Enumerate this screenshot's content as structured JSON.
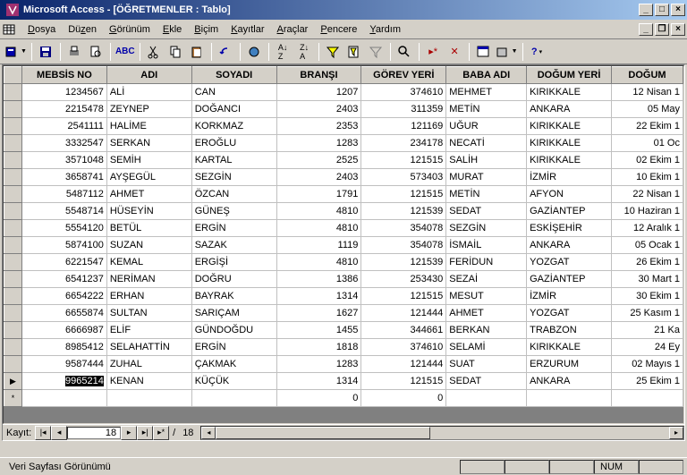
{
  "window": {
    "title": "Microsoft Access - [ÖĞRETMENLER : Tablo]"
  },
  "menu": {
    "items": [
      "Dosya",
      "Düzen",
      "Görünüm",
      "Ekle",
      "Biçim",
      "Kayıtlar",
      "Araçlar",
      "Pencere",
      "Yardım"
    ]
  },
  "nav": {
    "label": "Kayıt:",
    "current": "18",
    "total": "18",
    "sep": "/"
  },
  "status": {
    "view": "Veri Sayfası Görünümü",
    "num": "NUM"
  },
  "columns": [
    "MEBSİS NO",
    "ADI",
    "SOYADI",
    "BRANŞI",
    "GÖREV YERİ",
    "BABA ADI",
    "DOĞUM YERİ",
    "DOĞUM"
  ],
  "rows": [
    {
      "sel": "",
      "mebsis": "1234567",
      "adi": "ALİ",
      "soyadi": "CAN",
      "bransi": "1207",
      "gorev": "374610",
      "baba": "MEHMET",
      "dogumyeri": "KIRIKKALE",
      "dogum": "12 Nisan 1"
    },
    {
      "sel": "",
      "mebsis": "2215478",
      "adi": "ZEYNEP",
      "soyadi": "DOĞANCI",
      "bransi": "2403",
      "gorev": "311359",
      "baba": "METİN",
      "dogumyeri": "ANKARA",
      "dogum": "05 May"
    },
    {
      "sel": "",
      "mebsis": "2541111",
      "adi": "HALİME",
      "soyadi": "KORKMAZ",
      "bransi": "2353",
      "gorev": "121169",
      "baba": "UĞUR",
      "dogumyeri": "KIRIKKALE",
      "dogum": "22 Ekim 1"
    },
    {
      "sel": "",
      "mebsis": "3332547",
      "adi": "SERKAN",
      "soyadi": "EROĞLU",
      "bransi": "1283",
      "gorev": "234178",
      "baba": "NECATİ",
      "dogumyeri": "KIRIKKALE",
      "dogum": "01 Oc"
    },
    {
      "sel": "",
      "mebsis": "3571048",
      "adi": "SEMİH",
      "soyadi": "KARTAL",
      "bransi": "2525",
      "gorev": "121515",
      "baba": "SALİH",
      "dogumyeri": "KIRIKKALE",
      "dogum": "02 Ekim 1"
    },
    {
      "sel": "",
      "mebsis": "3658741",
      "adi": "AYŞEGÜL",
      "soyadi": "SEZGİN",
      "bransi": "2403",
      "gorev": "573403",
      "baba": "MURAT",
      "dogumyeri": "İZMİR",
      "dogum": "10 Ekim 1"
    },
    {
      "sel": "",
      "mebsis": "5487112",
      "adi": "AHMET",
      "soyadi": "ÖZCAN",
      "bransi": "1791",
      "gorev": "121515",
      "baba": "METİN",
      "dogumyeri": "AFYON",
      "dogum": "22 Nisan 1"
    },
    {
      "sel": "",
      "mebsis": "5548714",
      "adi": "HÜSEYİN",
      "soyadi": "GÜNEŞ",
      "bransi": "4810",
      "gorev": "121539",
      "baba": "SEDAT",
      "dogumyeri": "GAZİANTEP",
      "dogum": "10 Haziran 1"
    },
    {
      "sel": "",
      "mebsis": "5554120",
      "adi": "BETÜL",
      "soyadi": "ERGİN",
      "bransi": "4810",
      "gorev": "354078",
      "baba": "SEZGİN",
      "dogumyeri": "ESKİŞEHİR",
      "dogum": "12 Aralık 1"
    },
    {
      "sel": "",
      "mebsis": "5874100",
      "adi": "SUZAN",
      "soyadi": "SAZAK",
      "bransi": "1119",
      "gorev": "354078",
      "baba": "İSMAİL",
      "dogumyeri": "ANKARA",
      "dogum": "05 Ocak 1"
    },
    {
      "sel": "",
      "mebsis": "6221547",
      "adi": "KEMAL",
      "soyadi": "ERGİŞİ",
      "bransi": "4810",
      "gorev": "121539",
      "baba": "FERİDUN",
      "dogumyeri": "YOZGAT",
      "dogum": "26 Ekim 1"
    },
    {
      "sel": "",
      "mebsis": "6541237",
      "adi": "NERİMAN",
      "soyadi": "DOĞRU",
      "bransi": "1386",
      "gorev": "253430",
      "baba": "SEZAİ",
      "dogumyeri": "GAZİANTEP",
      "dogum": "30 Mart 1"
    },
    {
      "sel": "",
      "mebsis": "6654222",
      "adi": "ERHAN",
      "soyadi": "BAYRAK",
      "bransi": "1314",
      "gorev": "121515",
      "baba": "MESUT",
      "dogumyeri": "İZMİR",
      "dogum": "30 Ekim 1"
    },
    {
      "sel": "",
      "mebsis": "6655874",
      "adi": "SULTAN",
      "soyadi": "SARIÇAM",
      "bransi": "1627",
      "gorev": "121444",
      "baba": "AHMET",
      "dogumyeri": "YOZGAT",
      "dogum": "25 Kasım 1"
    },
    {
      "sel": "",
      "mebsis": "6666987",
      "adi": "ELİF",
      "soyadi": "GÜNDOĞDU",
      "bransi": "1455",
      "gorev": "344661",
      "baba": "BERKAN",
      "dogumyeri": "TRABZON",
      "dogum": "21 Ka"
    },
    {
      "sel": "",
      "mebsis": "8985412",
      "adi": "SELAHATTİN",
      "soyadi": "ERGİN",
      "bransi": "1818",
      "gorev": "374610",
      "baba": "SELAMİ",
      "dogumyeri": "KIRIKKALE",
      "dogum": "24 Ey"
    },
    {
      "sel": "",
      "mebsis": "9587444",
      "adi": "ZUHAL",
      "soyadi": "ÇAKMAK",
      "bransi": "1283",
      "gorev": "121444",
      "baba": "SUAT",
      "dogumyeri": "ERZURUM",
      "dogum": "02 Mayıs 1"
    },
    {
      "sel": "▶",
      "mebsis": "9965214",
      "adi": "KENAN",
      "soyadi": "KÜÇÜK",
      "bransi": "1314",
      "gorev": "121515",
      "baba": "SEDAT",
      "dogumyeri": "ANKARA",
      "dogum": "25 Ekim 1",
      "selected": true
    }
  ],
  "newrow": {
    "sel": "*",
    "bransi": "0",
    "gorev": "0"
  }
}
